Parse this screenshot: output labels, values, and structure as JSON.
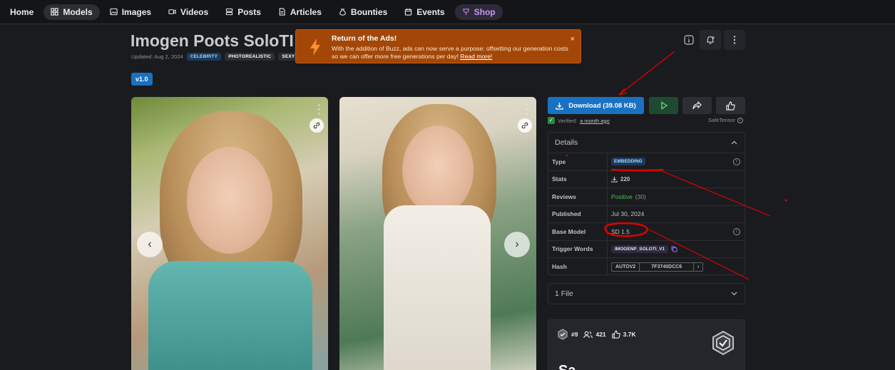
{
  "nav": {
    "items": [
      {
        "label": "Home"
      },
      {
        "label": "Models"
      },
      {
        "label": "Images"
      },
      {
        "label": "Videos"
      },
      {
        "label": "Posts"
      },
      {
        "label": "Articles"
      },
      {
        "label": "Bounties"
      },
      {
        "label": "Events"
      },
      {
        "label": "Shop"
      }
    ]
  },
  "model": {
    "title": "Imogen Poots SoloTI",
    "updated": "Updated: Aug 2, 2024",
    "tags": [
      "CELEBRITY",
      "PHOTOREALISTIC",
      "SEXY"
    ],
    "version": "v1.0"
  },
  "toast": {
    "title": "Return of the Ads!",
    "text": "With the addition of Buzz, ads can now serve a purpose: offsetting our generation costs so we can offer more free generations per day! ",
    "link": "Read more!",
    "close": "×"
  },
  "actions": {
    "download_label": "Download (39.08 KB)",
    "verified_prefix": "Verified:",
    "verified_time": "a month ago",
    "safetensor": "SafeTensor"
  },
  "details": {
    "heading": "Details",
    "rows": {
      "type_label": "Type",
      "type_value": "EMBEDDING",
      "stats_label": "Stats",
      "stats_value": "220",
      "reviews_label": "Reviews",
      "reviews_value": "Positive",
      "reviews_count": "(30)",
      "published_label": "Published",
      "published_value": "Jul 30, 2024",
      "base_label": "Base Model",
      "base_value": "SD 1.5",
      "trigger_label": "Trigger Words",
      "trigger_value": "IMOGENP_SOLOTI_V1",
      "hash_label": "Hash",
      "hash_algo": "AUTOV2",
      "hash_value": "7F3740DCC6"
    }
  },
  "files": {
    "label": "1 File"
  },
  "creator_card": {
    "rank": "#9",
    "followers": "421",
    "likes": "3.7K",
    "partial_text": "Sa"
  },
  "colors": {
    "accent": "#1971c2",
    "toast_bg": "#a34708",
    "annotation": "#e00000",
    "positive": "#40c057"
  }
}
